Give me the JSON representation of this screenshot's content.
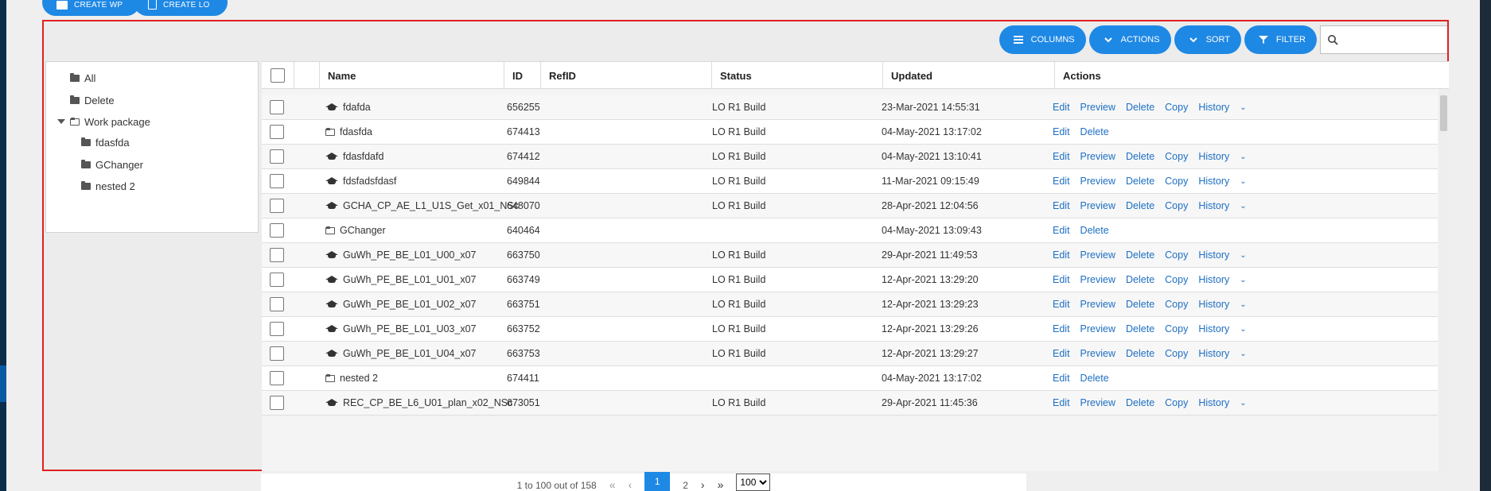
{
  "top_buttons": {
    "create_wp": "CREATE WP",
    "create_lo": "CREATE LO"
  },
  "toolbar": {
    "columns": "COLUMNS",
    "actions": "ACTIONS",
    "sort": "SORT",
    "filter": "FILTER",
    "search_placeholder": ""
  },
  "tree": {
    "items": [
      {
        "label": "All"
      },
      {
        "label": "Delete"
      },
      {
        "label": "Work package"
      },
      {
        "label": "fdasfda"
      },
      {
        "label": "GChanger"
      },
      {
        "label": "nested 2"
      }
    ]
  },
  "grid": {
    "headers": {
      "name": "Name",
      "id": "ID",
      "refid": "RefID",
      "status": "Status",
      "updated": "Updated",
      "actions": "Actions"
    },
    "action_labels": {
      "edit": "Edit",
      "preview": "Preview",
      "delete": "Delete",
      "copy": "Copy",
      "history": "History"
    },
    "rows": [
      {
        "name": "fdafda",
        "id": "656255",
        "status": "LO R1 Build",
        "updated": "23-Mar-2021 14:55:31"
      },
      {
        "name": "fdasfda",
        "id": "674413",
        "status": "LO R1 Build",
        "updated": "04-May-2021 13:17:02"
      },
      {
        "name": "fdasfdafd",
        "id": "674412",
        "status": "LO R1 Build",
        "updated": "04-May-2021 13:10:41"
      },
      {
        "name": "fdsfadsfdasf",
        "id": "649844",
        "status": "LO R1 Build",
        "updated": "11-Mar-2021 09:15:49"
      },
      {
        "name": "GCHA_CP_AE_L1_U1S_Get_x01_NSc",
        "id": "648070",
        "status": "LO R1 Build",
        "updated": "28-Apr-2021 12:04:56"
      },
      {
        "name": "GChanger",
        "id": "640464",
        "status": "",
        "updated": "04-May-2021 13:09:43"
      },
      {
        "name": "GuWh_PE_BE_L01_U00_x07",
        "id": "663750",
        "status": "LO R1 Build",
        "updated": "29-Apr-2021 11:49:53"
      },
      {
        "name": "GuWh_PE_BE_L01_U01_x07",
        "id": "663749",
        "status": "LO R1 Build",
        "updated": "12-Apr-2021 13:29:20"
      },
      {
        "name": "GuWh_PE_BE_L01_U02_x07",
        "id": "663751",
        "status": "LO R1 Build",
        "updated": "12-Apr-2021 13:29:23"
      },
      {
        "name": "GuWh_PE_BE_L01_U03_x07",
        "id": "663752",
        "status": "LO R1 Build",
        "updated": "12-Apr-2021 13:29:26"
      },
      {
        "name": "GuWh_PE_BE_L01_U04_x07",
        "id": "663753",
        "status": "LO R1 Build",
        "updated": "12-Apr-2021 13:29:27"
      },
      {
        "name": "nested 2",
        "id": "674411",
        "status": "",
        "updated": "04-May-2021 13:17:02"
      },
      {
        "name": "REC_CP_BE_L6_U01_plan_x02_NSc",
        "id": "673051",
        "status": "LO R1 Build",
        "updated": "29-Apr-2021 11:45:36"
      }
    ]
  },
  "pager": {
    "summary": "1 to 100 out of 158",
    "page_current": "1",
    "page_next": "2",
    "page_size": "100"
  }
}
